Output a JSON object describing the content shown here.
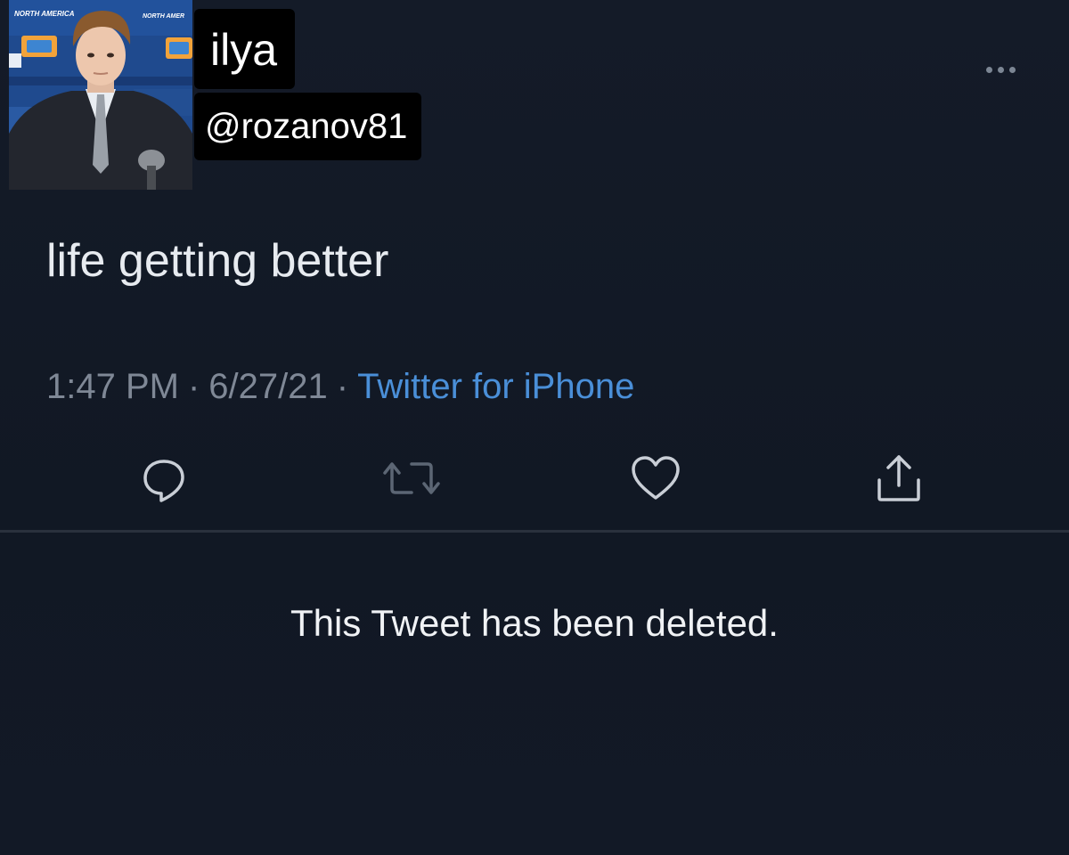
{
  "profile": {
    "display_name": "ilya",
    "handle": "@rozanov81",
    "avatar_icon": "person-photo",
    "avatar_backdrop_text": "NORTH AMERICA"
  },
  "menu": {
    "icon": "more-horizontal-icon"
  },
  "tweet": {
    "text": "life getting better",
    "time": "1:47 PM",
    "date": "6/27/21",
    "separator": "·",
    "source": "Twitter for iPhone"
  },
  "actions": {
    "reply_icon": "reply-icon",
    "retweet_icon": "retweet-icon",
    "like_icon": "heart-icon",
    "share_icon": "share-icon"
  },
  "status": {
    "deleted_message": "This Tweet has been deleted."
  },
  "colors": {
    "background": "#131a26",
    "text": "#e7ebf0",
    "muted": "#7f8896",
    "link": "#4a8fd8",
    "label_background": "#000000"
  }
}
